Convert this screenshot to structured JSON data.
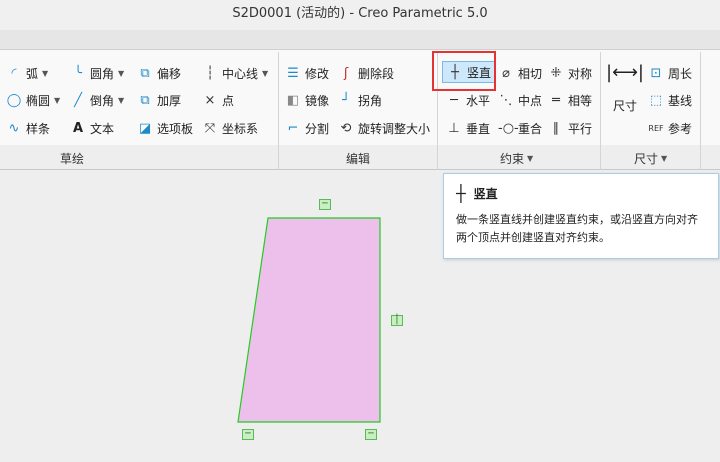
{
  "window": {
    "title": "S2D0001 (活动的) - Creo Parametric 5.0"
  },
  "ribbon": {
    "sketch": {
      "label": "草绘",
      "items": [
        "弧",
        "椭圆",
        "样条",
        "圆角",
        "倒角",
        "文本",
        "偏移",
        "加厚",
        "选项板",
        "中心线",
        "点",
        "坐标系"
      ]
    },
    "edit": {
      "label": "编辑",
      "items": [
        "修改",
        "镜像",
        "分割",
        "删除段",
        "拐角",
        "旋转调整大小"
      ]
    },
    "constrain": {
      "label": "约束",
      "items": [
        "竖直",
        "水平",
        "垂直",
        "相切",
        "中点",
        "重合",
        "对称",
        "相等",
        "平行"
      ]
    },
    "dimension": {
      "label": "尺寸",
      "items": [
        "尺寸",
        "周长",
        "基线",
        "参考"
      ]
    }
  },
  "tooltip": {
    "title": "竖直",
    "body": "做一条竖直线并创建竖直约束，或沿竖直方向对齐两个顶点并创建竖直对齐约束。"
  },
  "colors": {
    "shape_fill": "#ecc0ea",
    "shape_edge": "#22cc22",
    "highlight": "#e53333"
  }
}
